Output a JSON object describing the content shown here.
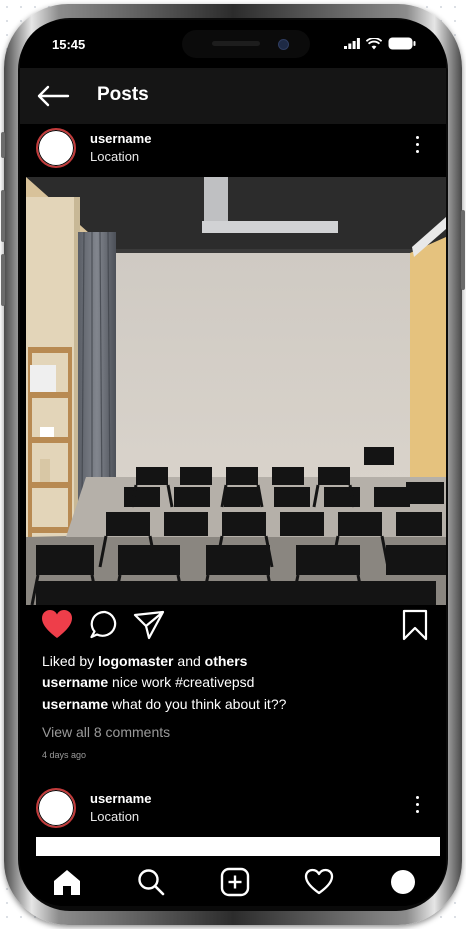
{
  "status_bar": {
    "time": "15:45"
  },
  "header": {
    "title": "Posts"
  },
  "post": {
    "username": "username",
    "location": "Location",
    "liked_by_prefix": "Liked by",
    "liked_by_user": "logomaster",
    "liked_by_and": "and",
    "liked_by_others": "others",
    "caption_user": "username",
    "caption_text": "nice work #creativepsd",
    "comment_user": "username",
    "comment_text": "what do you think about it??",
    "view_comments": "View all 8 comments",
    "time_ago": "4 days ago",
    "liked": true
  },
  "next_post": {
    "username": "username",
    "location": "Location"
  },
  "icons": {
    "back": "arrow-left-icon",
    "more": "vertical-ellipsis-icon",
    "like": "heart-filled-icon",
    "comment": "speech-bubble-icon",
    "share": "paper-plane-icon",
    "save": "bookmark-icon",
    "nav": [
      "home-icon",
      "search-icon",
      "add-square-icon",
      "heart-outline-icon",
      "profile-avatar-icon"
    ]
  },
  "colors": {
    "like": "#ee3e4a",
    "background": "#000000",
    "topbar": "#151515"
  }
}
